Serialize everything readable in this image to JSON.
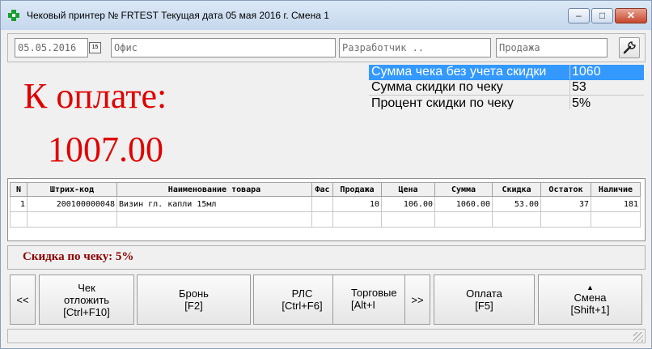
{
  "window": {
    "title": "Чековый принтер № FRTEST  Текущая дата 05 мая 2016 г.   Смена 1",
    "minimize_label": "–",
    "maximize_label": "□",
    "close_label": "✕"
  },
  "toolbar": {
    "date_value": "05.05.2016",
    "date_button_label": "15",
    "office_value": "Офис",
    "developer_value": "Разработчик ..",
    "sale_value": "Продажа"
  },
  "summary": {
    "pay_label": "К оплате:",
    "pay_amount": "1007.00",
    "rows": [
      {
        "label": "Сумма чека без учета скидки",
        "value": "1060"
      },
      {
        "label": "Сумма скидки по чеку",
        "value": "53"
      },
      {
        "label": "Процент скидки по чеку",
        "value": "5%"
      }
    ]
  },
  "table": {
    "columns": [
      "N",
      "Штрих-код",
      "Наименование товара",
      "Фас",
      "Продажа",
      "Цена",
      "Сумма",
      "Скидка",
      "Остаток",
      "Наличие"
    ],
    "rows": [
      [
        "1",
        "200100000048",
        "Визин гл. капли 15мл",
        "",
        "10",
        "106.00",
        "1060.00",
        "53.00",
        "37",
        "181"
      ]
    ]
  },
  "discount": {
    "text": "Скидка по чеку: 5%"
  },
  "buttons": {
    "prev": "<<",
    "next": ">>",
    "postpone_line1": "Чек",
    "postpone_line2": "отложить",
    "postpone_line3": "[Ctrl+F10]",
    "reserve_line1": "Бронь",
    "reserve_line2": "[F2]",
    "rls_line1": "РЛС",
    "rls_line2": "[Ctrl+F6]",
    "trade_line1": "Торговые",
    "trade_line2": "[Alt+I",
    "payment_line1": "Оплата",
    "payment_line2": "[F5]",
    "shift_line1": "Смена",
    "shift_line2": "[Shift+1]"
  },
  "colors": {
    "pay_red": "#e00000",
    "selection_blue": "#3399ff",
    "discount_text": "#8b0000"
  },
  "icons": {
    "app": "pharmacy-cross-icon",
    "settings": "wrench-icon",
    "calendar": "calendar-icon"
  }
}
